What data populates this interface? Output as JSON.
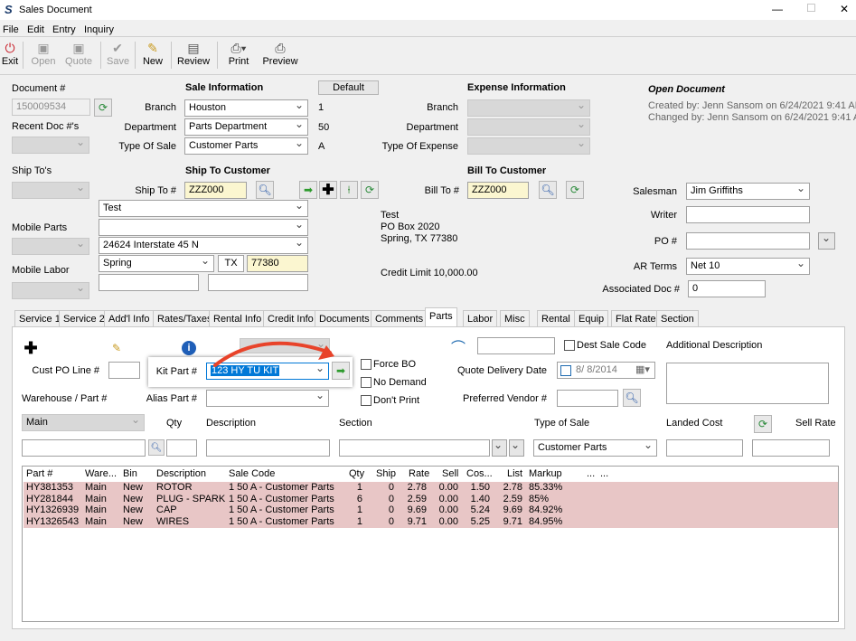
{
  "window": {
    "title": "Sales Document",
    "minimize": "—",
    "maximize": "☐",
    "close": "✕"
  },
  "menu": [
    "File",
    "Edit",
    "Entry",
    "Inquiry"
  ],
  "toolbar": {
    "exit": "Exit",
    "open": "Open",
    "quote": "Quote",
    "save": "Save",
    "new": "New",
    "review": "Review",
    "print": "Print",
    "preview": "Preview"
  },
  "doc": {
    "doc_label": "Document #",
    "doc_value": "150009534",
    "recent_label": "Recent Doc #'s",
    "ship_tos_label": "Ship To's",
    "mobile_parts_label": "Mobile Parts",
    "mobile_labor_label": "Mobile Labor"
  },
  "sale_info": {
    "heading": "Sale Information",
    "default_btn": "Default",
    "branch_label": "Branch",
    "branch": "Houston",
    "branch_code": "1",
    "dept_label": "Department",
    "dept": "Parts Department",
    "dept_code": "50",
    "type_label": "Type Of Sale",
    "type": "Customer Parts",
    "type_code": "A"
  },
  "expense_info": {
    "heading": "Expense Information",
    "branch_label": "Branch",
    "dept_label": "Department",
    "type_label": "Type Of Expense"
  },
  "open_doc": {
    "heading": "Open Document",
    "created": "Created by: Jenn Sansom on 6/24/2021 9:41 AM",
    "changed": "Changed by: Jenn Sansom on 6/24/2021 9:41 AM"
  },
  "ship_to": {
    "heading": "Ship To Customer",
    "label": "Ship To #",
    "value": "ZZZ000",
    "name": "Test",
    "addr2": "",
    "addr3": "24624 Interstate 45 N",
    "city": "Spring",
    "state": "TX",
    "zip": "77380"
  },
  "bill_to": {
    "heading": "Bill To Customer",
    "label": "Bill To #",
    "value": "ZZZ000",
    "name": "Test",
    "addr1": "PO Box 2020",
    "city_line": "Spring, TX  77380",
    "credit": "Credit Limit 10,000.00"
  },
  "right_fields": {
    "salesman_label": "Salesman",
    "salesman": "Jim Griffiths",
    "writer_label": "Writer",
    "po_label": "PO #",
    "terms_label": "AR Terms",
    "terms": "Net 10",
    "assoc_label": "Associated Doc #",
    "assoc": "0"
  },
  "tabs": [
    "Service 1",
    "Service 2",
    "Add'l Info",
    "Rates/Taxes",
    "Rental Info",
    "Credit Info",
    "Documents",
    "Comments",
    "Parts",
    "Labor",
    "Misc",
    "Rental",
    "Equip",
    "Flat Rate",
    "Section"
  ],
  "parts": {
    "cust_po_label": "Cust PO Line #",
    "kit_label": "Kit Part #",
    "kit_value": "123 HY TU KIT",
    "force_bo": "Force BO",
    "no_demand": "No Demand",
    "dont_print": "Don't Print",
    "quote_date_label": "Quote Delivery Date",
    "quote_date": "8/  8/2014",
    "dest_code": "Dest Sale Code",
    "add_desc": "Additional Description",
    "preferred_vendor": "Preferred Vendor #",
    "warehouse_label": "Warehouse / Part #",
    "alias_label": "Alias Part #",
    "warehouse": "Main",
    "qty": "Qty",
    "description": "Description",
    "section": "Section",
    "type_of_sale": "Type of Sale",
    "type_value": "Customer Parts",
    "landed_cost": "Landed Cost",
    "sell_rate": "Sell Rate"
  },
  "grid": {
    "headers": [
      "Part #",
      "Ware...",
      "Bin",
      "Description",
      "Sale Code",
      "Qty",
      "Ship",
      "Rate",
      "Sell",
      "Cos...",
      "List",
      "Markup",
      "...",
      "...",
      "..."
    ],
    "rows": [
      [
        "HY381353",
        "Main",
        "New",
        "ROTOR",
        "1 50 A - Customer Parts",
        "1",
        "0",
        "2.78",
        "0.00",
        "1.50",
        "2.78",
        "85.33%"
      ],
      [
        "HY281844",
        "Main",
        "New",
        "PLUG - SPARK",
        "1 50 A - Customer Parts",
        "6",
        "0",
        "2.59",
        "0.00",
        "1.40",
        "2.59",
        "85%"
      ],
      [
        "HY1326939",
        "Main",
        "New",
        "CAP",
        "1 50 A - Customer Parts",
        "1",
        "0",
        "9.69",
        "0.00",
        "5.24",
        "9.69",
        "84.92%"
      ],
      [
        "HY1326543",
        "Main",
        "New",
        "WIRES",
        "1 50 A - Customer Parts",
        "1",
        "0",
        "9.71",
        "0.00",
        "5.25",
        "9.71",
        "84.95%"
      ]
    ]
  },
  "colors": {
    "accent": "#0078d7",
    "highlight_row": "#e8c6c6",
    "arrow": "#e8432a"
  }
}
